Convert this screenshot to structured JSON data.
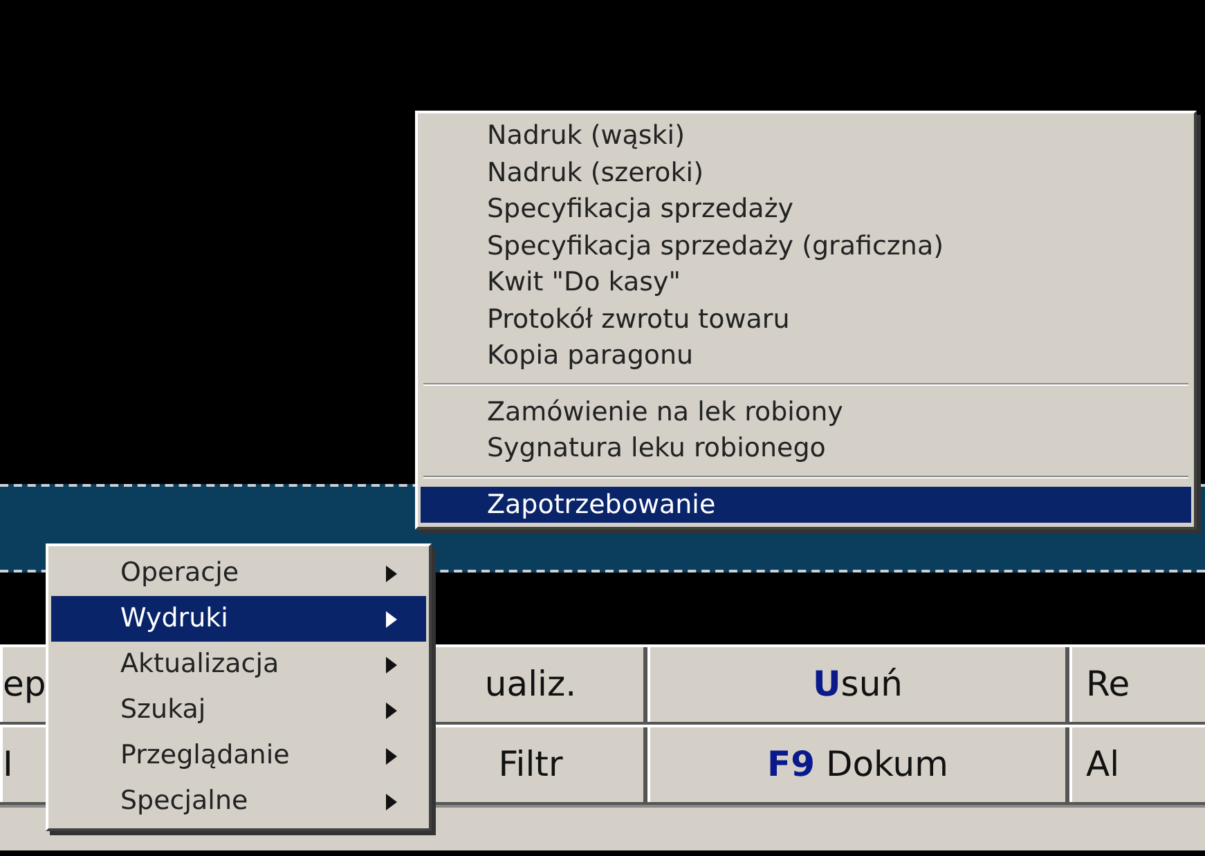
{
  "main_menu": {
    "items": [
      {
        "label": "Operacje",
        "selected": false
      },
      {
        "label": "Wydruki",
        "selected": true
      },
      {
        "label": "Aktualizacja",
        "selected": false
      },
      {
        "label": "Szukaj",
        "selected": false
      },
      {
        "label": "Przeglądanie",
        "selected": false
      },
      {
        "label": "Specjalne",
        "selected": false
      }
    ]
  },
  "submenu": {
    "items": [
      {
        "kind": "item",
        "label": "Nadruk (wąski)",
        "selected": false
      },
      {
        "kind": "item",
        "label": "Nadruk (szeroki)",
        "selected": false
      },
      {
        "kind": "item",
        "label": "Specyfikacja sprzedaży",
        "selected": false
      },
      {
        "kind": "item",
        "label": "Specyfikacja sprzedaży (graficzna)",
        "selected": false
      },
      {
        "kind": "item",
        "label": "Kwit \"Do kasy\"",
        "selected": false
      },
      {
        "kind": "item",
        "label": "Protokół zwrotu towaru",
        "selected": false
      },
      {
        "kind": "item",
        "label": "Kopia paragonu",
        "selected": false
      },
      {
        "kind": "separator"
      },
      {
        "kind": "item",
        "label": "Zamówienie na lek robiony",
        "selected": false
      },
      {
        "kind": "item",
        "label": "Sygnatura leku robionego",
        "selected": false
      },
      {
        "kind": "separator"
      },
      {
        "kind": "item",
        "label": "Zapotrzebowanie",
        "selected": true
      }
    ]
  },
  "buttons": {
    "rows": [
      [
        "ep",
        "ualiz.",
        "**U**suń",
        "Re"
      ],
      [
        "I",
        "Filtr",
        "**F9** Dokum",
        "Al"
      ]
    ]
  }
}
